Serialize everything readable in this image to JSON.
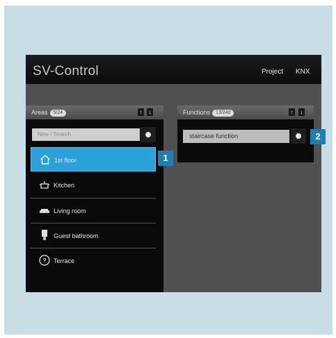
{
  "app": {
    "title": "SV-Control",
    "menu": {
      "project": "Project",
      "knx": "KNX"
    }
  },
  "areas": {
    "title": "Areas",
    "count": "5/24",
    "search_placeholder": "New / Search",
    "items": [
      {
        "label": "1st floor",
        "icon": "house-icon",
        "selected": true
      },
      {
        "label": "Kitchen",
        "icon": "pot-icon"
      },
      {
        "label": "Living room",
        "icon": "sofa-icon"
      },
      {
        "label": "Guest bathroom",
        "icon": "shower-icon"
      },
      {
        "label": "Terrace",
        "icon": "question-icon"
      }
    ]
  },
  "functions": {
    "title": "Functions",
    "count": "13/240",
    "field_value": "staircase function"
  },
  "sort": {
    "up": "↑",
    "down": "↓"
  },
  "callouts": {
    "one": "1",
    "two": "2"
  },
  "colors": {
    "accent": "#2aa1d8",
    "callout": "#1e7fb2",
    "background": "#c9dde7"
  }
}
